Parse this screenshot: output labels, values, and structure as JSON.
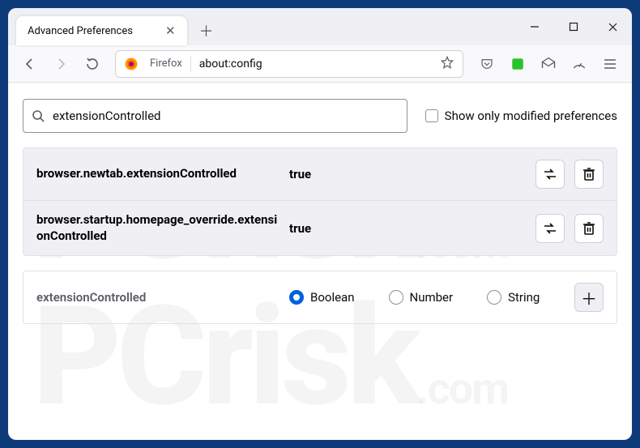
{
  "tab": {
    "title": "Advanced Preferences"
  },
  "urlbar": {
    "brand": "Firefox",
    "url": "about:config"
  },
  "search": {
    "value": "extensionControlled",
    "modifiedOnlyLabel": "Show only modified preferences"
  },
  "prefs": [
    {
      "name": "browser.newtab.extensionControlled",
      "value": "true"
    },
    {
      "name": "browser.startup.homepage_override.extensionControlled",
      "value": "true"
    }
  ],
  "newPref": {
    "name": "extensionControlled",
    "types": {
      "boolean": "Boolean",
      "number": "Number",
      "string": "String"
    }
  },
  "watermark": {
    "brand": "PCrisk",
    "suffix": ".com"
  }
}
